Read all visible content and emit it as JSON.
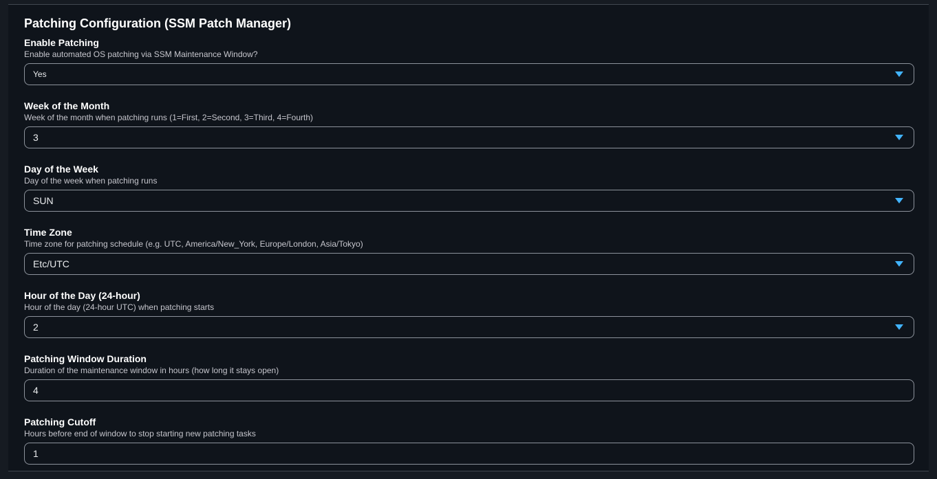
{
  "section": {
    "title": "Patching Configuration (SSM Patch Manager)"
  },
  "fields": [
    {
      "label": "Enable Patching",
      "description": "Enable automated OS patching via SSM Maintenance Window?",
      "value": "Yes",
      "type": "select"
    },
    {
      "label": "Week of the Month",
      "description": "Week of the month when patching runs (1=First, 2=Second, 3=Third, 4=Fourth)",
      "value": "3",
      "type": "select"
    },
    {
      "label": "Day of the Week",
      "description": "Day of the week when patching runs",
      "value": "SUN",
      "type": "select"
    },
    {
      "label": "Time Zone",
      "description": "Time zone for patching schedule (e.g. UTC, America/New_York, Europe/London, Asia/Tokyo)",
      "value": "Etc/UTC",
      "type": "select"
    },
    {
      "label": "Hour of the Day (24-hour)",
      "description": "Hour of the day (24-hour UTC) when patching starts",
      "value": "2",
      "type": "select"
    },
    {
      "label": "Patching Window Duration",
      "description": "Duration of the maintenance window in hours (how long it stays open)",
      "value": "4",
      "type": "input"
    },
    {
      "label": "Patching Cutoff",
      "description": "Hours before end of window to stop starting new patching tasks",
      "value": "1",
      "type": "input"
    }
  ],
  "icons": {
    "dropdown": "caret-down-icon"
  },
  "colors": {
    "accent": "#42b4ff",
    "background": "#0f141b",
    "border": "#8d939c"
  }
}
